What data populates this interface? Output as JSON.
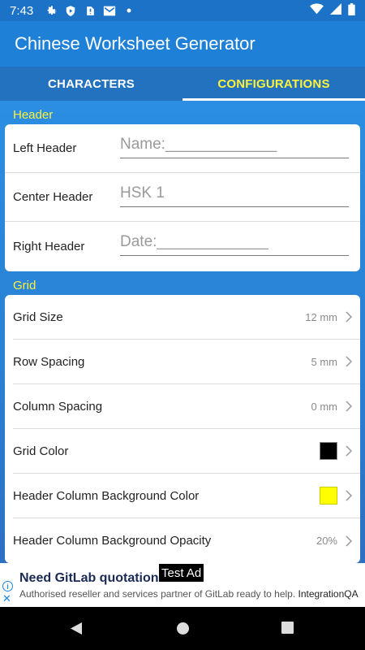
{
  "status_bar": {
    "time": "7:43",
    "left_icons": [
      "gear-icon",
      "shield-play-icon",
      "no-sim-icon",
      "gmail-icon",
      "dot-icon"
    ],
    "right_icons": [
      "wifi-icon",
      "signal-icon",
      "battery-icon"
    ]
  },
  "app_bar": {
    "title": "Chinese Worksheet Generator"
  },
  "tabs": [
    {
      "label": "CHARACTERS",
      "active": false
    },
    {
      "label": "CONFIGURATIONS",
      "active": true
    }
  ],
  "header_section": {
    "title": "Header",
    "rows": [
      {
        "label": "Left Header",
        "value": "Name:_____________"
      },
      {
        "label": "Center Header",
        "value": "HSK 1"
      },
      {
        "label": "Right Header",
        "value": "Date:_____________"
      }
    ]
  },
  "grid_section": {
    "title": "Grid",
    "rows": [
      {
        "label": "Grid Size",
        "value": "12 mm"
      },
      {
        "label": "Row Spacing",
        "value": "5 mm"
      },
      {
        "label": "Column Spacing",
        "value": "0 mm"
      },
      {
        "label": "Grid Color",
        "color": "#000000"
      },
      {
        "label": "Header Column Background Color",
        "color": "#ffff00"
      },
      {
        "label": "Header Column Background Opacity",
        "value": "20%"
      }
    ]
  },
  "ad": {
    "headline": "Need GitLab quotation fast?",
    "body": "Authorised reseller and services partner of GitLab ready to help.",
    "brand": "IntegrationQA",
    "badge": "Test Ad"
  },
  "nav_bar": {
    "icons": [
      "back-icon",
      "home-icon",
      "recents-icon"
    ]
  },
  "colors": {
    "accent_yellow": "#fff23a",
    "primary_blue": "#1f80d8"
  }
}
